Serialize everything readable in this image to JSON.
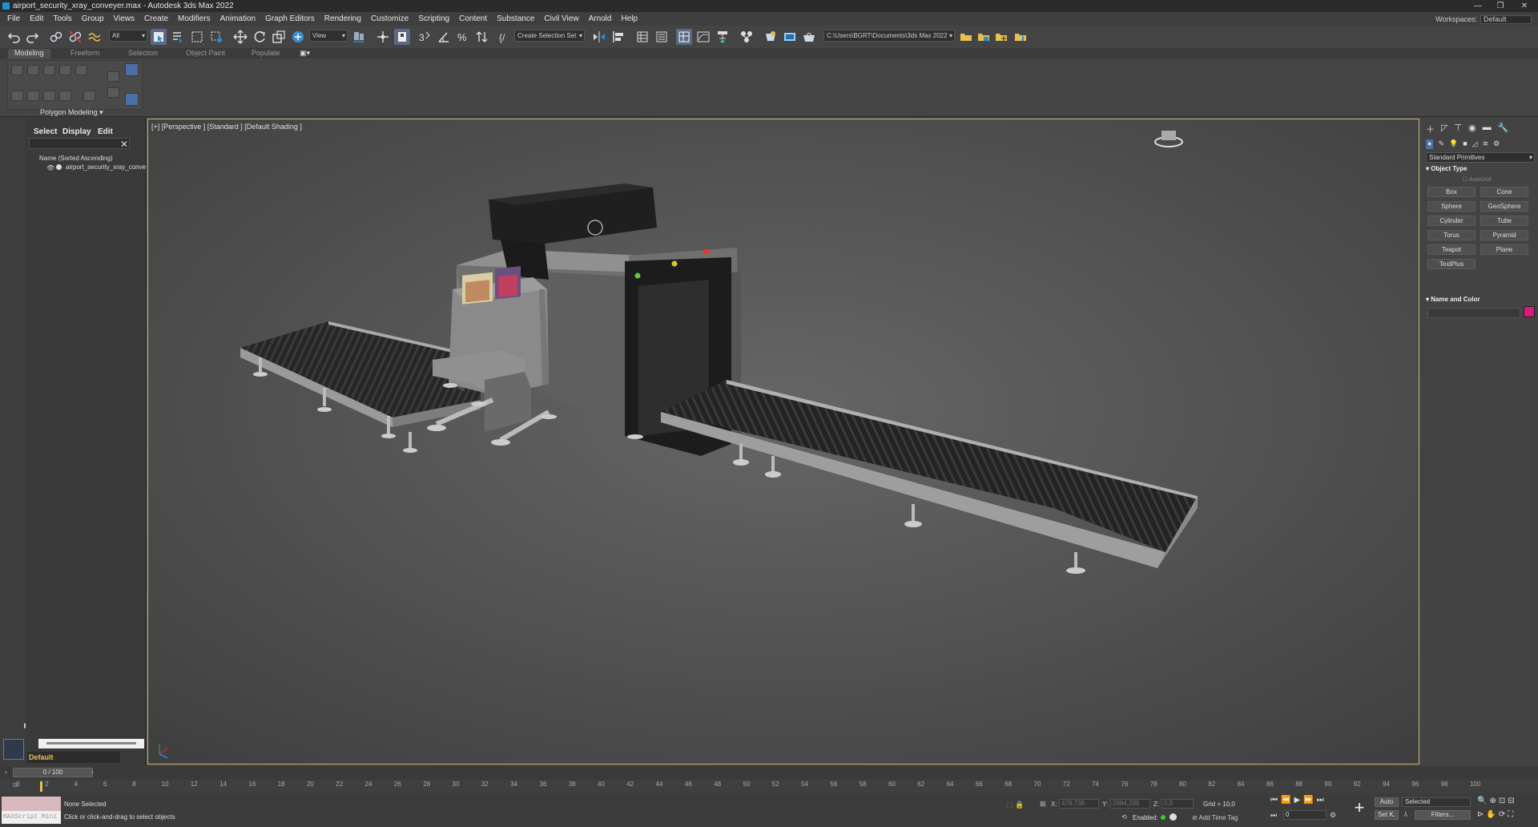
{
  "window": {
    "title": "airport_security_xray_conveyer.max - Autodesk 3ds Max 2022",
    "workspaces_label": "Workspaces:",
    "workspace": "Default"
  },
  "menu": [
    "File",
    "Edit",
    "Tools",
    "Group",
    "Views",
    "Create",
    "Modifiers",
    "Animation",
    "Graph Editors",
    "Rendering",
    "Customize",
    "Scripting",
    "Content",
    "Substance",
    "Civil View",
    "Arnold",
    "Help"
  ],
  "toolbar": {
    "filter": "All",
    "view_dropdown": "View",
    "selection_set": "Create Selection Set",
    "project_path": "C:\\Users\\BGRT\\Documents\\3ds Max 2022"
  },
  "ribbon": {
    "tabs": [
      "Modeling",
      "Freeform",
      "Selection",
      "Object Paint",
      "Populate"
    ],
    "panel_label": "Polygon Modeling"
  },
  "explorer": {
    "tabs": [
      "Select",
      "Display",
      "Edit"
    ],
    "column_header": "Name (Sorted Ascending)",
    "object": "airport_security_xray_conve",
    "layer": "Default"
  },
  "viewport": {
    "label": "[+] [Perspective ] [Standard ] [Default Shading ]"
  },
  "command_panel": {
    "category": "Standard Primitives",
    "object_type_header": "Object Type",
    "autogrid": "AutoGrid",
    "buttons": [
      "Box",
      "Cone",
      "Sphere",
      "GeoSphere",
      "Cylinder",
      "Tube",
      "Torus",
      "Pyramid",
      "Teapot",
      "Plane",
      "TextPlus"
    ],
    "name_color_header": "Name and Color",
    "object_color": "#d81b7f"
  },
  "timeline": {
    "frame": "0 / 100",
    "ticks": [
      "0",
      "2",
      "4",
      "6",
      "8",
      "10",
      "12",
      "14",
      "16",
      "18",
      "20",
      "22",
      "24",
      "26",
      "28",
      "30",
      "32",
      "34",
      "36",
      "38",
      "40",
      "42",
      "44",
      "46",
      "48",
      "50",
      "52",
      "54",
      "56",
      "58",
      "60",
      "62",
      "64",
      "66",
      "68",
      "70",
      "72",
      "74",
      "76",
      "78",
      "80",
      "82",
      "84",
      "86",
      "88",
      "90",
      "92",
      "94",
      "96",
      "98",
      "100"
    ]
  },
  "status": {
    "selection": "None Selected",
    "prompt": "Click or click-and-drag to select objects",
    "maxscript": "MAXScript Mini",
    "x_label": "X:",
    "x": "479,738",
    "y_label": "Y:",
    "y": "2984,295",
    "z_label": "Z:",
    "z": "0,0",
    "grid": "Grid = 10,0",
    "enabled": "Enabled:",
    "add_time_tag": "Add Time Tag",
    "auto": "Auto",
    "set_key": "Set K.",
    "key_mode": "Selected",
    "filters": "Filters...",
    "current_frame": "0"
  }
}
